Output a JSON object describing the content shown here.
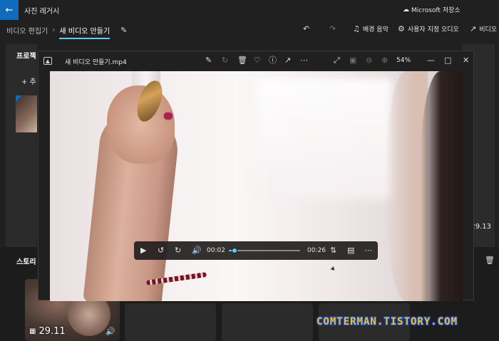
{
  "app": {
    "back_icon": "back-arrow-icon",
    "title": "사진 레거시",
    "store_label": "Microsoft 저장소"
  },
  "toolbar": {
    "breadcrumb_root": "비디오 편집기",
    "breadcrumb_current": "새 비디오 만들기",
    "undo_icon": "undo-icon",
    "redo_icon": "redo-icon",
    "bg_music_label": "배경 음악",
    "custom_audio_label": "사용자 지정 오디오",
    "export_label": "비디오"
  },
  "project_panel": {
    "title": "프로젝",
    "add_label": "+ 추"
  },
  "right_panel": {
    "duration_label": ":29.13"
  },
  "storyboard": {
    "title": "스토리",
    "clip_duration": "29.11"
  },
  "player": {
    "title": "새 비디오 만들기.mp4",
    "zoom": "54%",
    "current_time": "00:02",
    "total_time": "00:26",
    "progress_fraction": 0.077
  },
  "watermark": "COMTERMAN.TISTORY.COM",
  "colors": {
    "accent": "#0f6cbd",
    "seek": "#60cdff",
    "watermark": "#f0c020"
  }
}
